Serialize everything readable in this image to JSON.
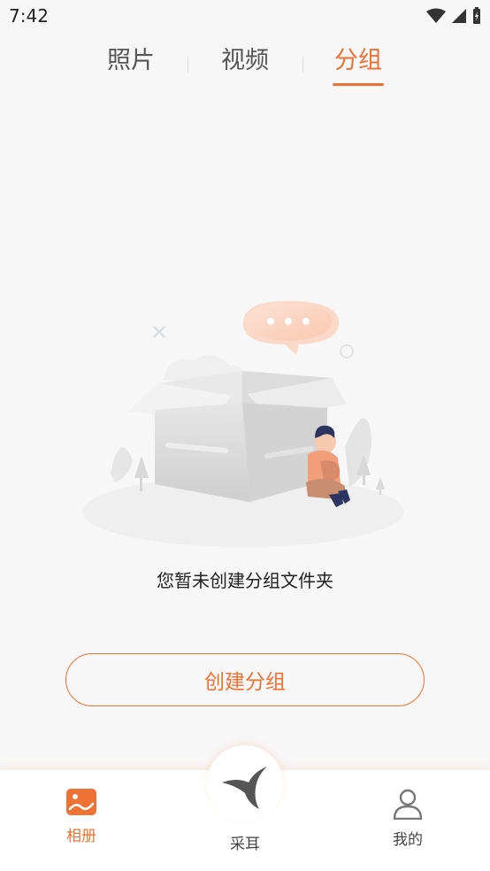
{
  "status": {
    "time": "7:42"
  },
  "tabs": [
    {
      "label": "照片"
    },
    {
      "label": "视频"
    },
    {
      "label": "分组"
    }
  ],
  "active_tab": "分组",
  "empty_state": {
    "message": "您暂未创建分组文件夹"
  },
  "create_button": {
    "label": "创建分组"
  },
  "bottom_nav": {
    "left": {
      "label": "相册",
      "icon": "album-icon"
    },
    "center": {
      "label": "采耳",
      "icon": "bird-logo-icon"
    },
    "right": {
      "label": "我的",
      "icon": "person-icon"
    }
  },
  "colors": {
    "accent": "#ee7233",
    "background": "#f7f7f7"
  }
}
